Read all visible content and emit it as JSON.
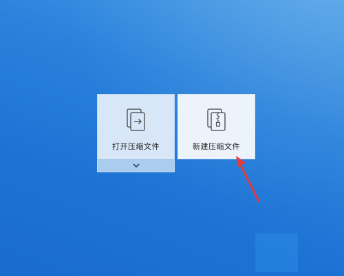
{
  "desktop": {
    "background_top": "#4a9ee6",
    "background_bottom": "#1a6ccd"
  },
  "tiles": {
    "open_archive": {
      "label": "打开压缩文件",
      "icon": "open-file-arrow-icon"
    },
    "new_archive": {
      "label": "新建压缩文件",
      "icon": "zip-file-icon"
    }
  },
  "dropdown": {
    "icon": "chevron-down-icon"
  },
  "annotation": {
    "color": "#e53a3a",
    "icon": "red-pointer-arrow"
  }
}
